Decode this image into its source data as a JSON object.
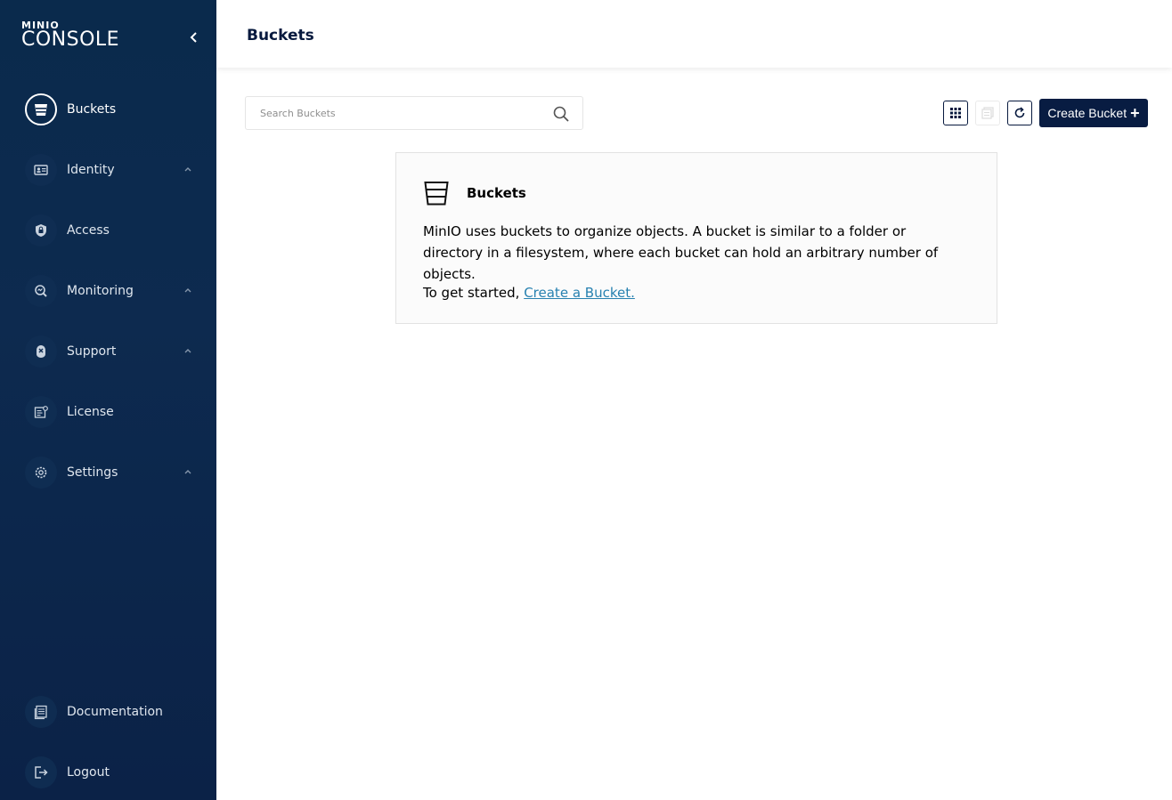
{
  "sidebar": {
    "logo_brand": "MINIO",
    "logo_product": "CONSOLE",
    "items": [
      {
        "label": "Buckets",
        "icon": "bucket-icon",
        "active": true
      },
      {
        "label": "Identity",
        "icon": "id-card-icon",
        "expandable": true
      },
      {
        "label": "Access",
        "icon": "lock-shield-icon"
      },
      {
        "label": "Monitoring",
        "icon": "monitoring-magnifier-icon",
        "expandable": true
      },
      {
        "label": "Support",
        "icon": "support-icon",
        "expandable": true
      },
      {
        "label": "License",
        "icon": "license-icon"
      },
      {
        "label": "Settings",
        "icon": "gear-icon",
        "expandable": true
      }
    ],
    "bottom_items": [
      {
        "label": "Documentation",
        "icon": "documentation-icon"
      },
      {
        "label": "Logout",
        "icon": "logout-icon"
      }
    ]
  },
  "header": {
    "title": "Buckets"
  },
  "toolbar": {
    "search_placeholder": "Search Buckets",
    "search_value": "",
    "create_label": "Create Bucket"
  },
  "empty_state": {
    "title": "Buckets",
    "description": "MinIO uses buckets to organize objects. A bucket is similar to a folder or directory in a filesystem, where each bucket can hold an arbitrary number of objects.",
    "cta_prefix": "To get started,",
    "cta_link": "Create a Bucket."
  },
  "colors": {
    "sidebar_bg": "#0d2a4f",
    "primary_button": "#081c42",
    "link": "#2781b0"
  }
}
